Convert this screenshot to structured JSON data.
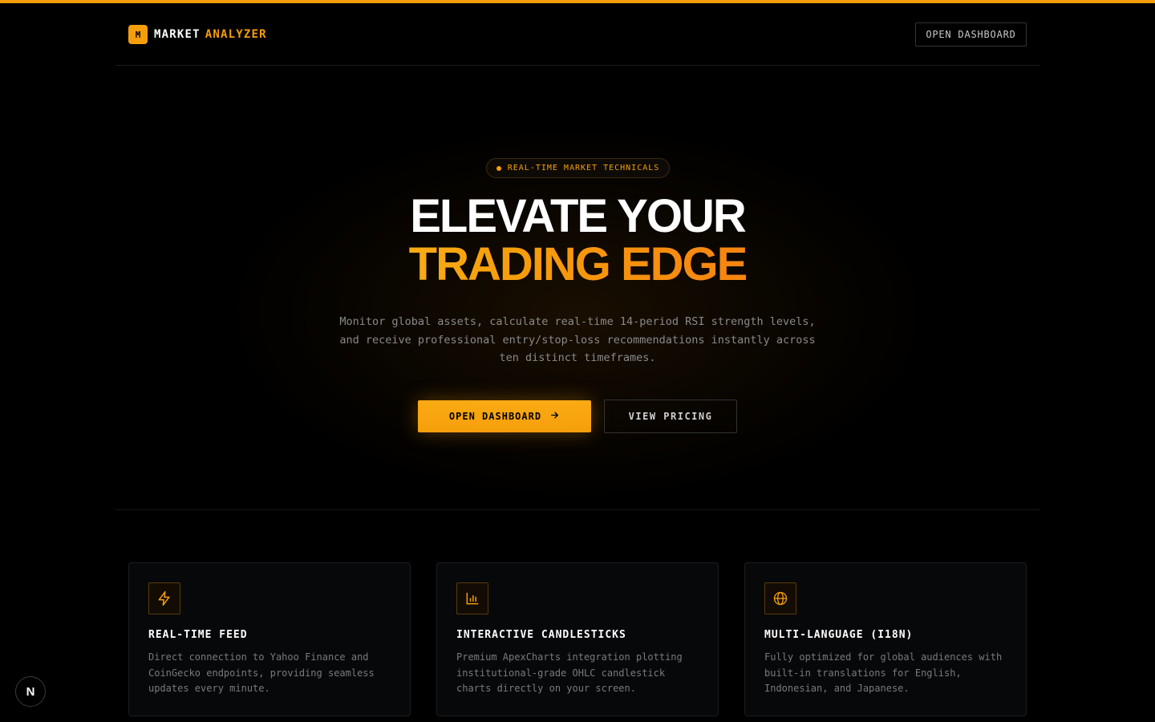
{
  "header": {
    "logo_mark": "M",
    "logo_word1": "MARKET",
    "logo_word2": "ANALYZER",
    "open_dashboard_label": "OPEN DASHBOARD"
  },
  "hero": {
    "badge": "REAL-TIME MARKET TECHNICALS",
    "title_line1": "ELEVATE YOUR",
    "title_line2": "TRADING EDGE",
    "description": "Monitor global assets, calculate real-time 14-period RSI strength levels, and receive professional entry/stop-loss recommendations instantly across ten distinct timeframes.",
    "primary_cta": "OPEN DASHBOARD",
    "secondary_cta": "VIEW PRICING"
  },
  "features": [
    {
      "icon": "lightning-icon",
      "title": "REAL-TIME FEED",
      "description": "Direct connection to Yahoo Finance and CoinGecko endpoints, providing seamless updates every minute."
    },
    {
      "icon": "bar-chart-icon",
      "title": "INTERACTIVE CANDLESTICKS",
      "description": "Premium ApexCharts integration plotting institutional-grade OHLC candlestick charts directly on your screen."
    },
    {
      "icon": "globe-icon",
      "title": "MULTI-LANGUAGE (I18N)",
      "description": "Fully optimized for global audiences with built-in translations for English, Indonesian, and Japanese."
    }
  ],
  "dev_badge": "N",
  "colors": {
    "accent": "#f59e0b",
    "background": "#000000",
    "muted_text": "#8a8a8a"
  }
}
